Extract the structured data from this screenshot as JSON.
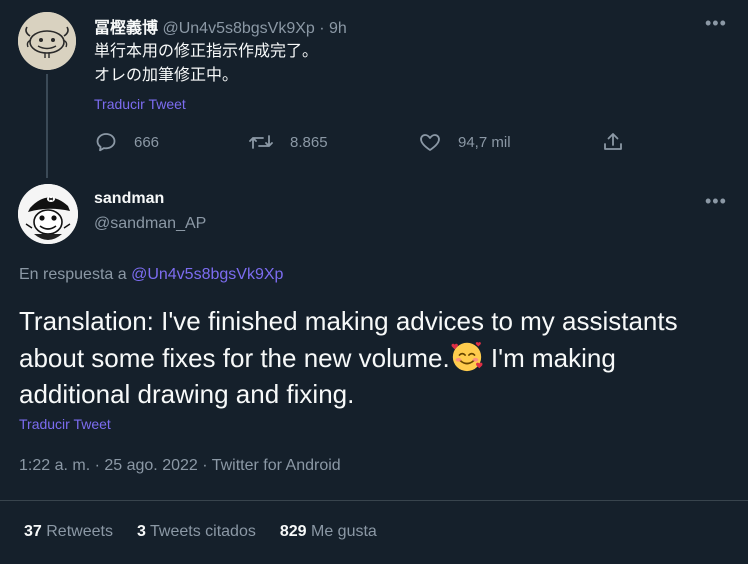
{
  "parent_tweet": {
    "name": "冨樫義博",
    "handle": "@Un4v5s8bgsVk9Xp",
    "separator": "·",
    "time": "9h",
    "lines": [
      "単行本用の修正指示作成完了。",
      "オレの加筆修正中。"
    ],
    "translate_label": "Traducir Tweet",
    "actions": {
      "replies": "666",
      "retweets": "8.865",
      "likes": "94,7 mil"
    }
  },
  "main_tweet": {
    "name": "sandman",
    "handle": "@sandman_AP",
    "reply_prefix": "En respuesta a",
    "reply_handle": "@Un4v5s8bgsVk9Xp",
    "text_part1": "Translation: I've finished making advices to my assistants about some fixes for the new volume.",
    "text_part2": " I'm making additional drawing and fixing.",
    "translate_label": "Traducir Tweet",
    "meta": "1:22 a. m. · 25 ago. 2022 · Twitter for Android",
    "stats": {
      "retweets_count": "37",
      "retweets_label": "Retweets",
      "quotes_count": "3",
      "quotes_label": "Tweets citados",
      "likes_count": "829",
      "likes_label": "Me gusta"
    }
  },
  "colors": {
    "background": "#15202b",
    "link": "#7c6cf0",
    "muted": "#8b98a5",
    "divider": "#38444d"
  }
}
